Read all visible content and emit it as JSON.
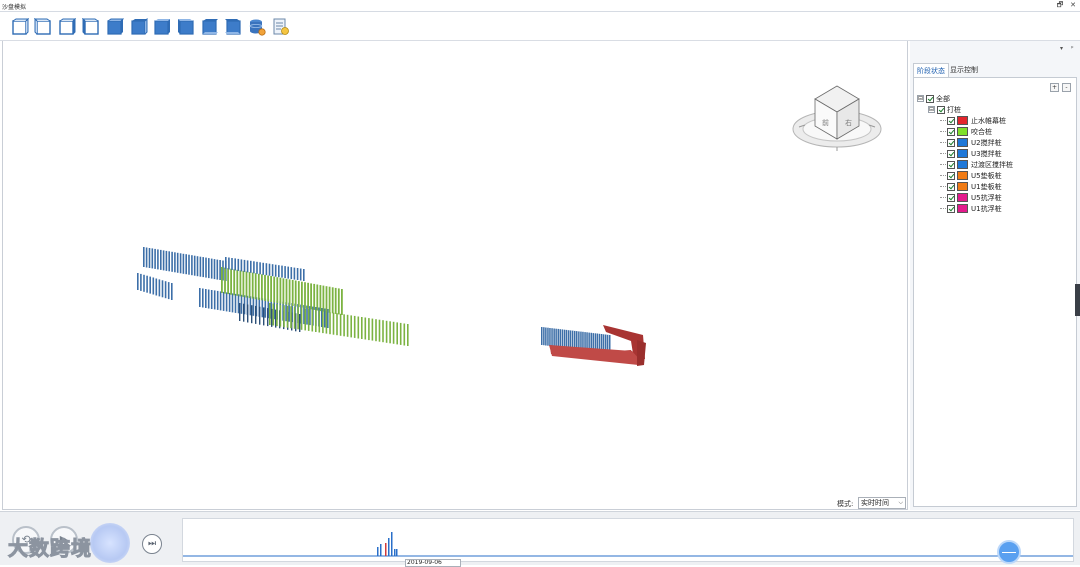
{
  "window": {
    "title": "沙盘模拟",
    "restore_glyph": "🗗",
    "close_glyph": "✕"
  },
  "toolbar": {
    "icons": [
      "view-front-icon",
      "view-back-icon",
      "view-left-icon",
      "view-right-icon",
      "view-top-icon",
      "view-bottom-icon",
      "view-ne-icon",
      "view-nw-icon",
      "view-se-icon",
      "view-sw-icon",
      "database-settings-icon",
      "report-icon"
    ]
  },
  "panel": {
    "tabs": [
      {
        "label": "阶段状态",
        "active": true
      },
      {
        "label": "显示控制",
        "active": false
      }
    ],
    "expand_all": "+",
    "collapse_all": "-",
    "tree": {
      "root": {
        "label": "全部",
        "expander": "⊟"
      },
      "group": {
        "label": "打桩",
        "expander": "⊟"
      },
      "items": [
        {
          "label": "止水帷幕桩",
          "color": "#e3262c"
        },
        {
          "label": "咬合桩",
          "color": "#7fe02a"
        },
        {
          "label": "U2搅拌桩",
          "color": "#1f78d8"
        },
        {
          "label": "U3搅拌桩",
          "color": "#1f78d8"
        },
        {
          "label": "过渡区搅拌桩",
          "color": "#1f78d8"
        },
        {
          "label": "U5垫板桩",
          "color": "#f07b15"
        },
        {
          "label": "U1垫板桩",
          "color": "#f07b15"
        },
        {
          "label": "U5抗浮桩",
          "color": "#e31a8c"
        },
        {
          "label": "U1抗浮桩",
          "color": "#e31a8c"
        }
      ]
    }
  },
  "viewport": {
    "mode_label": "模式:",
    "mode_value": "实时时间",
    "colors": {
      "blue": "#3d6fa8",
      "green": "#7cb342",
      "red": "#b8403f",
      "dark": "#2c4f78"
    }
  },
  "playback": {
    "rewind_glyph": "⟲",
    "play_glyph": "▶",
    "fast_forward_glyph": "⏭",
    "watermark": "大数跨境",
    "date_value": "2019-09-06"
  }
}
